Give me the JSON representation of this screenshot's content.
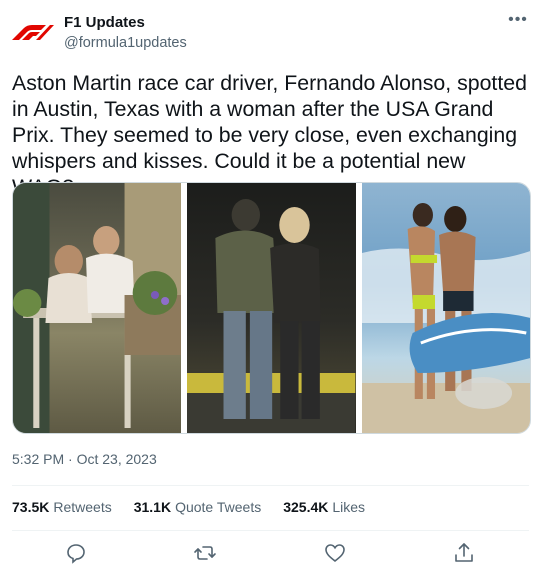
{
  "author": {
    "name": "F1 Updates",
    "handle": "@formula1updates",
    "avatar_icon": "f1-logo-icon",
    "brand_color": "#e10600"
  },
  "more_icon": "more-options-icon",
  "tweet": {
    "text": "Aston Martin race car driver, Fernando Alonso, spotted in Austin, Texas with a woman after the USA Grand Prix. They seemed to be very close, even exchanging whispers and kisses. Could it be a potential new WAG?",
    "timestamp": "5:32 PM · Oct 23, 2023"
  },
  "media": [
    {
      "description_icon": "photo-restaurant"
    },
    {
      "description_icon": "photo-night-walk"
    },
    {
      "description_icon": "photo-beach"
    }
  ],
  "stats": {
    "retweets_count": "73.5K",
    "retweets_label": "Retweets",
    "quotes_count": "31.1K",
    "quotes_label": "Quote Tweets",
    "likes_count": "325.4K",
    "likes_label": "Likes"
  },
  "actions": {
    "reply_icon": "reply-icon",
    "retweet_icon": "retweet-icon",
    "like_icon": "like-icon",
    "share_icon": "share-icon",
    "icon_color": "#536471"
  }
}
